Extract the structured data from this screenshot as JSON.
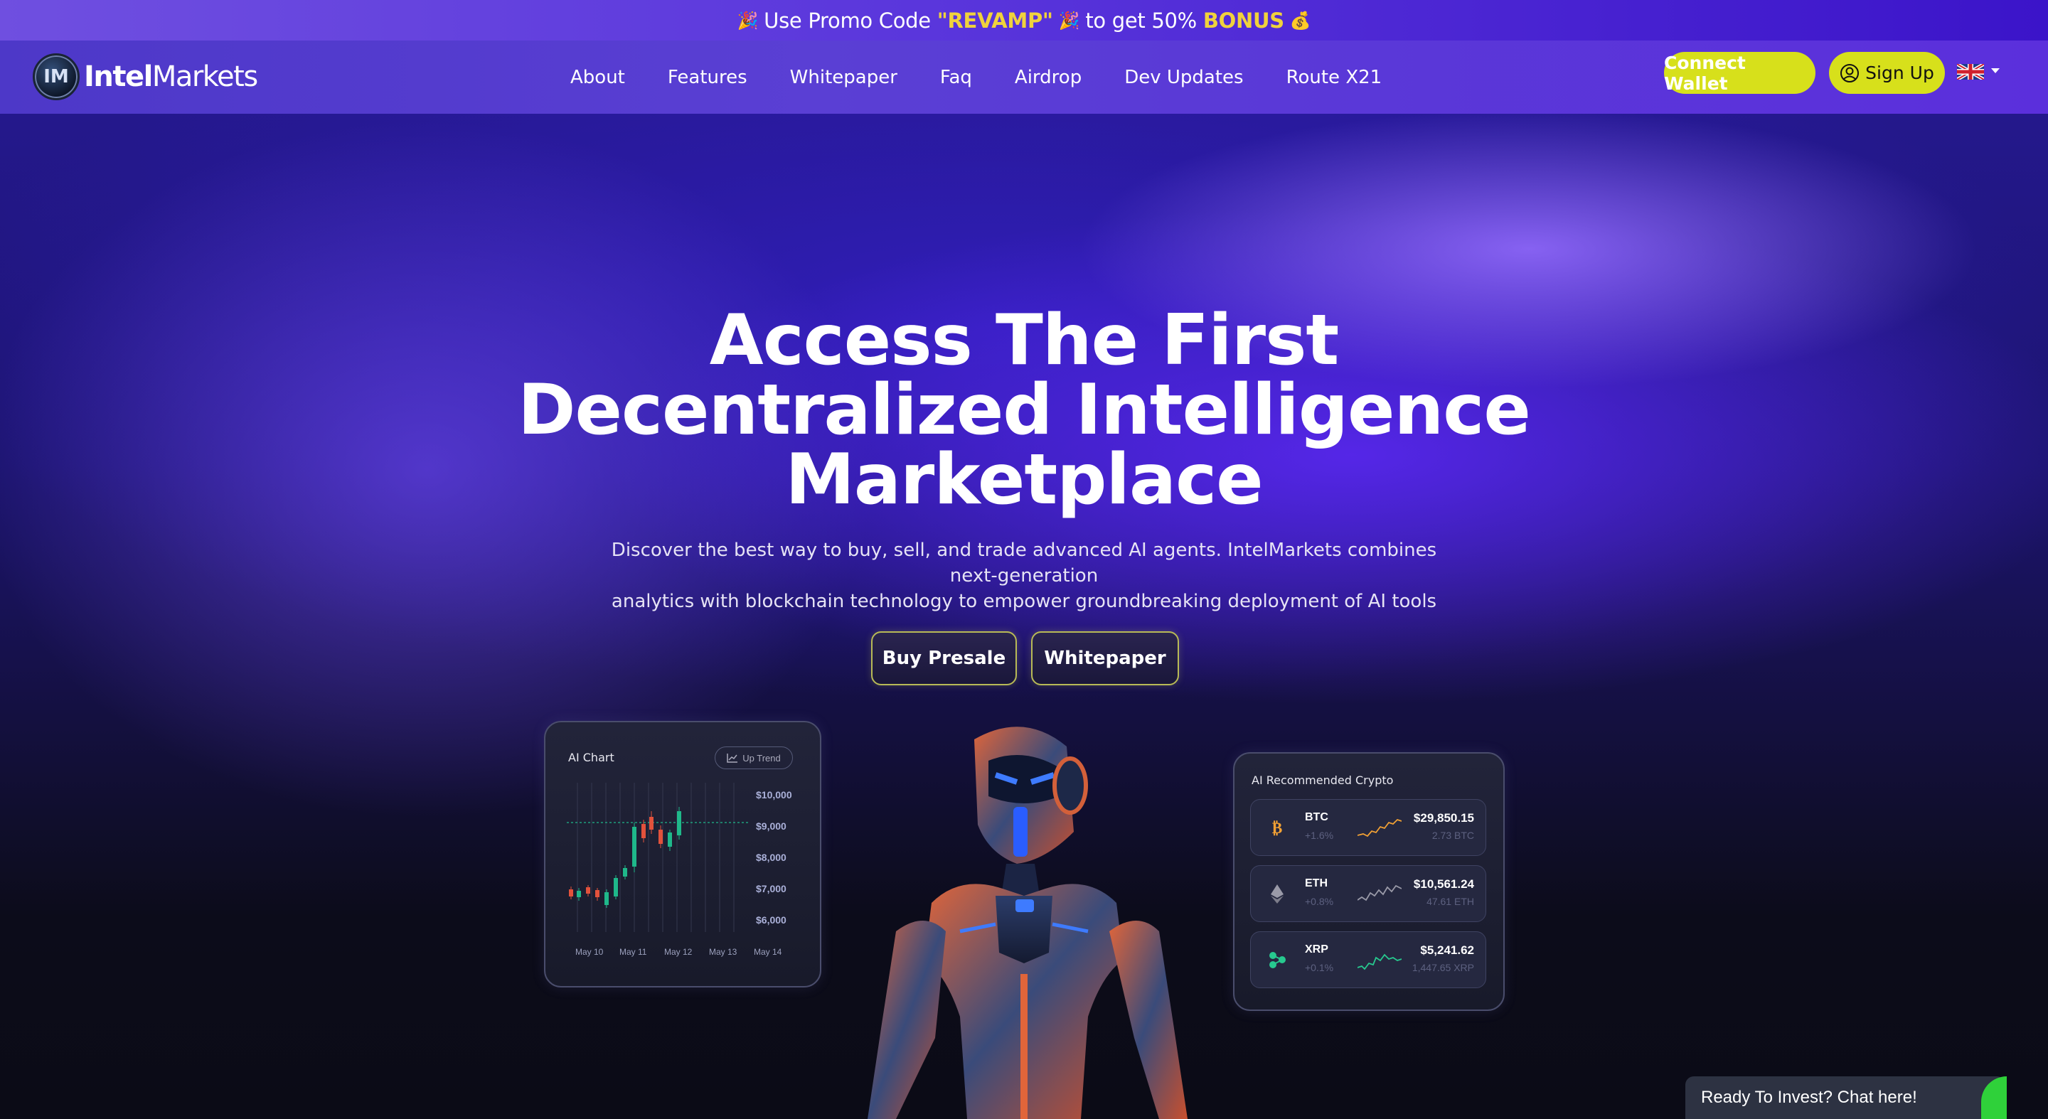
{
  "promo": {
    "prefix": "Use Promo Code",
    "code": "\"REVAMP\"",
    "middle": "to get 50%",
    "bonus": "BONUS",
    "emoji_left": "🎉",
    "emoji_mid": "🎉",
    "emoji_right": "💰"
  },
  "logo": {
    "bold": "Intel",
    "light": "Markets",
    "mark": "IM"
  },
  "nav": {
    "items": [
      "About",
      "Features",
      "Whitepaper",
      "Faq",
      "Airdrop",
      "Dev Updates",
      "Route X21"
    ],
    "connect_wallet": "Connect Wallet",
    "sign_up": "Sign Up",
    "language_flag": "uk-flag-icon"
  },
  "hero": {
    "title_line1": "Access The First",
    "title_line2": "Decentralized Intelligence",
    "title_line3": "Marketplace",
    "subtitle_line1": "Discover the best way to buy, sell, and trade advanced AI agents. IntelMarkets combines next-generation",
    "subtitle_line2": "analytics with blockchain technology to empower groundbreaking deployment of AI tools",
    "buy_presale": "Buy Presale",
    "whitepaper": "Whitepaper"
  },
  "ai_chart": {
    "title": "AI Chart",
    "trend_label": "Up Trend",
    "y_ticks": [
      "$10,000",
      "$9,000",
      "$8,000",
      "$7,000",
      "$6,000"
    ],
    "x_ticks": [
      "May 10",
      "May 11",
      "May 12",
      "May 13",
      "May 14"
    ],
    "colors": {
      "up": "#1fb88a",
      "down": "#e2523c"
    }
  },
  "ai_crypto": {
    "title": "AI Recommended Crypto",
    "coins": [
      {
        "symbol": "BTC",
        "change": "+1.6%",
        "price": "$29,850.15",
        "holding": "2.73 BTC",
        "icon": "bitcoin-icon",
        "color": "#f2a134"
      },
      {
        "symbol": "ETH",
        "change": "+0.8%",
        "price": "$10,561.24",
        "holding": "47.61 ETH",
        "icon": "ethereum-icon",
        "color": "#9a9aa8"
      },
      {
        "symbol": "XRP",
        "change": "+0.1%",
        "price": "$5,241.62",
        "holding": "1,447.65 XRP",
        "icon": "xrp-icon",
        "color": "#27c98f"
      }
    ]
  },
  "chat": {
    "label": "Ready To Invest? Chat here!"
  },
  "colors": {
    "accent": "#d7e01b",
    "promo_highlight": "#f0d23c"
  }
}
